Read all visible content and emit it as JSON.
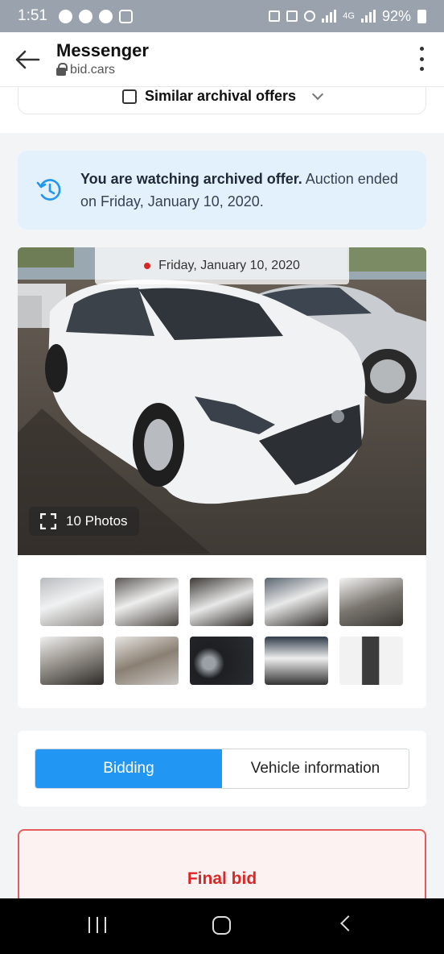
{
  "status_bar": {
    "time": "1:51",
    "battery": "92%",
    "network": "4G"
  },
  "app_bar": {
    "title": "Messenger",
    "domain": "bid.cars"
  },
  "similar_offers": {
    "label": "Similar archival offers"
  },
  "notice": {
    "bold": "You are watching archived offer.",
    "text": " Auction ended on Friday, January 10, 2020."
  },
  "gallery": {
    "date": "Friday, January 10, 2020",
    "photos_label": "10 Photos",
    "thumbnails": [
      "front-left exterior",
      "front exterior",
      "rear exterior",
      "rear-right exterior",
      "interior front seats",
      "interior rear seats",
      "engine bay",
      "instrument cluster",
      "rear view",
      "window sticker"
    ]
  },
  "tabs": {
    "items": [
      "Bidding",
      "Vehicle information"
    ],
    "active": "Bidding"
  },
  "bid": {
    "label": "Final bid"
  },
  "colors": {
    "accent": "#2196f3",
    "notice_bg": "#e3f1fd",
    "bid_red": "#dc2626"
  }
}
